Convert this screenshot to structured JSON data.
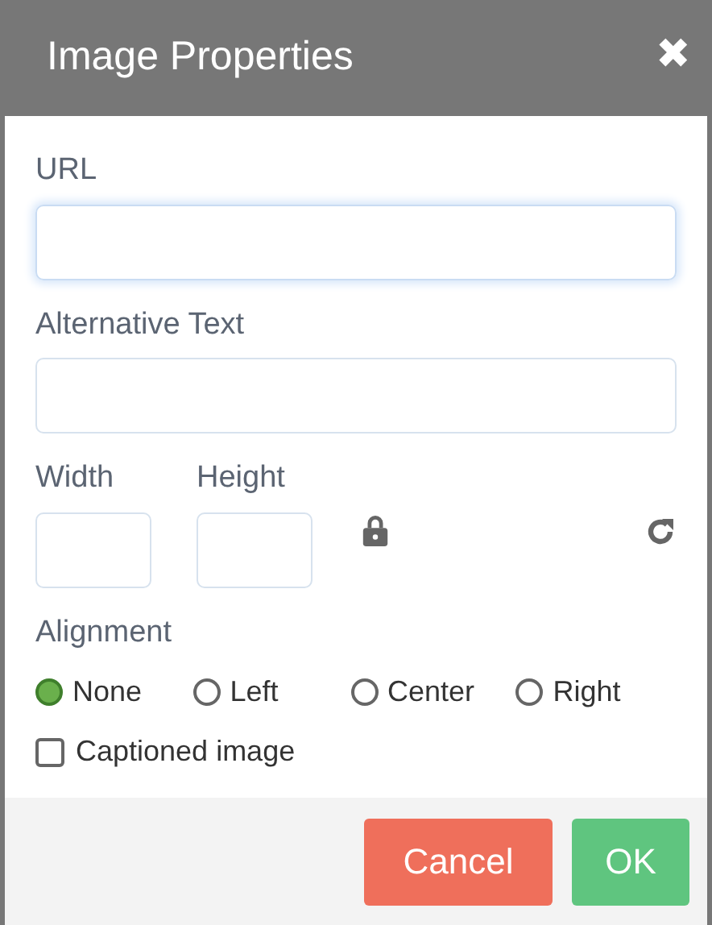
{
  "dialog": {
    "title": "Image Properties",
    "close": "✖"
  },
  "fields": [
    {
      "label": "URL",
      "focused": true
    },
    {
      "label": "Alternative Text",
      "focused": false
    }
  ],
  "size": {
    "width_label": "Width",
    "height_label": "Height"
  },
  "alignment": {
    "label": "Alignment",
    "options": [
      {
        "label": "None",
        "selected": true
      },
      {
        "label": "Left",
        "selected": false
      },
      {
        "label": "Center",
        "selected": false
      },
      {
        "label": "Right",
        "selected": false
      }
    ]
  },
  "captioned": {
    "label": "Captioned image",
    "checked": false
  },
  "buttons": [
    {
      "label": "Cancel",
      "kind": "cancel"
    },
    {
      "label": "OK",
      "kind": "ok"
    }
  ]
}
